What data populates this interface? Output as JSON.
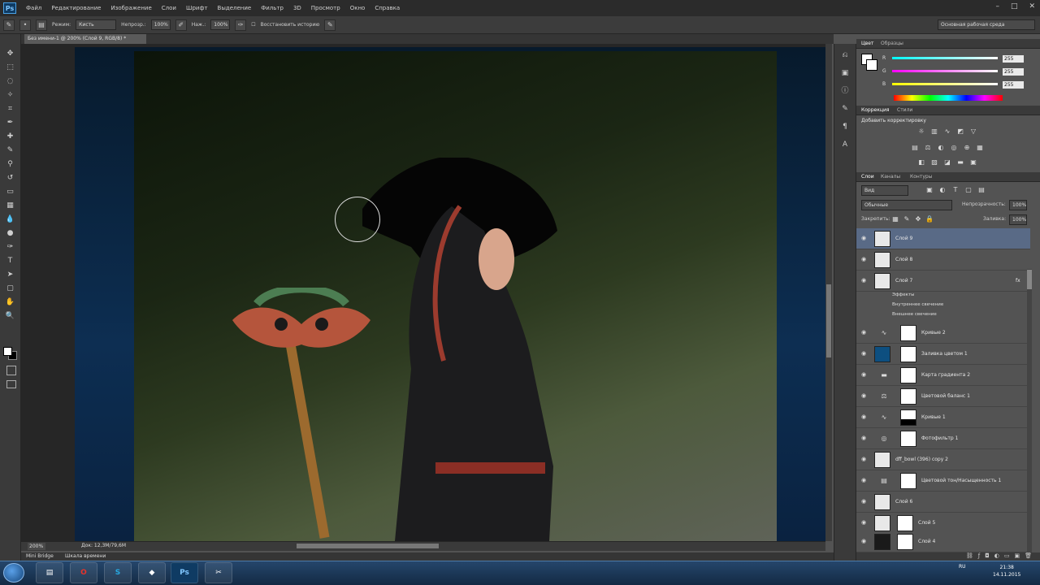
{
  "app": {
    "logo": "Ps"
  },
  "menu": [
    "Файл",
    "Редактирование",
    "Изображение",
    "Слои",
    "Шрифт",
    "Выделение",
    "Фильтр",
    "3D",
    "Просмотр",
    "Окно",
    "Справка"
  ],
  "options": {
    "mode_label": "Режим:",
    "mode_value": "Кисть",
    "opacity_label": "Непрозр.:",
    "opacity_value": "100%",
    "flow_label": "Наж.:",
    "flow_value": "100%",
    "history_label": "Восстановить историю",
    "workspace": "Основная рабочая среда"
  },
  "document": {
    "tab_title": "Без имени-1 @ 200% (Слой 9, RGB/8) *",
    "zoom": "200%",
    "doc_size": "Док: 12,3M/79,6M"
  },
  "bottom_tabs": [
    "Mini Bridge",
    "Шкала времени"
  ],
  "color_panel": {
    "tabs": [
      "Цвет",
      "Образцы"
    ],
    "r_label": "R",
    "r_value": "255",
    "g_label": "G",
    "g_value": "255",
    "b_label": "B",
    "b_value": "255"
  },
  "adjust_panel": {
    "tabs": [
      "Коррекция",
      "Стили"
    ],
    "title": "Добавить корректировку"
  },
  "layers_panel": {
    "tabs": [
      "Слои",
      "Каналы",
      "Контуры"
    ],
    "filter": "Вид",
    "blend_mode": "Обычные",
    "opacity_label": "Непрозрачность:",
    "opacity_value": "100%",
    "lock_label": "Закрепить:",
    "fill_label": "Заливка:",
    "fill_value": "100%",
    "layers": [
      {
        "name": "Слой 9"
      },
      {
        "name": "Слой 8"
      },
      {
        "name": "Слой 7"
      },
      {
        "name": "Кривые 2"
      },
      {
        "name": "Заливка цветом 1"
      },
      {
        "name": "Карта градиента 2"
      },
      {
        "name": "Цветовой баланс 1"
      },
      {
        "name": "Кривые 1"
      },
      {
        "name": "Фотофильтр 1"
      },
      {
        "name": "dff_bowl (396) copy 2"
      },
      {
        "name": "Цветовой тон/Насыщенность 1"
      },
      {
        "name": "Слой 6"
      },
      {
        "name": "Слой 5"
      },
      {
        "name": "Слой 4"
      }
    ],
    "effects_label": "Эффекты",
    "effect_1": "Внутреннее свечение",
    "effect_2": "Внешнее свечение",
    "fx": "fx"
  },
  "taskbar": {
    "ps_label": "Ps",
    "lang": "RU",
    "time": "21:38",
    "date": "14.11.2015"
  },
  "colors": {
    "accent": "#596a86",
    "taskbar": "#1d3a5c"
  }
}
